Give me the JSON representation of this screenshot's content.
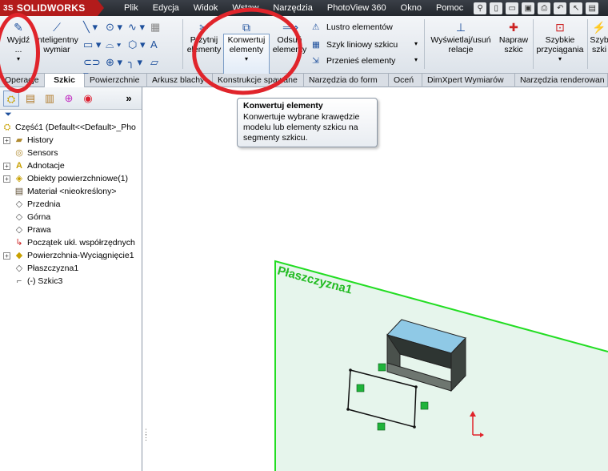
{
  "app": {
    "logo_prefix": "3S",
    "logo_text": "SOLIDWORKS"
  },
  "menu": {
    "items": [
      "Plik",
      "Edycja",
      "Widok",
      "Wstaw",
      "Narzędzia",
      "PhotoView 360",
      "Okno",
      "Pomoc"
    ]
  },
  "ribbon": {
    "exit_sketch": "Wyjdź ...",
    "smart_dimension": "Inteligentny wymiar",
    "trim": "Przytnij elementy",
    "convert": "Konwertuj elementy",
    "offset": "Odsuń elementy",
    "mirror": "Lustro elementów",
    "linear_pattern": "Szyk liniowy szkicu",
    "move": "Przenieś elementy",
    "display_relations": "Wyświetlaj/usuń relacje",
    "repair": "Napraw szkic",
    "quick_snaps": "Szybkie przyciągania",
    "rapid_sketch": "Szyb szki"
  },
  "tabs": [
    "Operacje",
    "Szkic",
    "Powierzchnie",
    "Arkusz blachy",
    "Konstrukcje spawane",
    "Narzędzia do form",
    "Oceń",
    "DimXpert Wymiarów",
    "Narzędzia renderowan"
  ],
  "active_tab": "Szkic",
  "tree": {
    "root": "Część1  (Default<<Default>_Pho",
    "items": [
      "History",
      "Sensors",
      "Adnotacje",
      "Obiekty powierzchniowe(1)",
      "Materiał <nieokreślony>",
      "Przednia",
      "Górna",
      "Prawa",
      "Początek ukł. współrzędnych",
      "Powierzchnia-Wyciągnięcie1",
      "Płaszczyzna1",
      "(-) Szkic3"
    ]
  },
  "tooltip": {
    "title": "Konwertuj elementy",
    "line1": "Konwertuje wybrane krawędzie",
    "line2": "modelu lub elementy szkicu na",
    "line3": "segmenty szkicu."
  },
  "viewport": {
    "plane_label": "Płaszczyzna1"
  },
  "colors": {
    "menubar": "#2b2f36",
    "logo": "#b31b1b",
    "plane": "#22dd22",
    "annotation": "#e0242b"
  }
}
